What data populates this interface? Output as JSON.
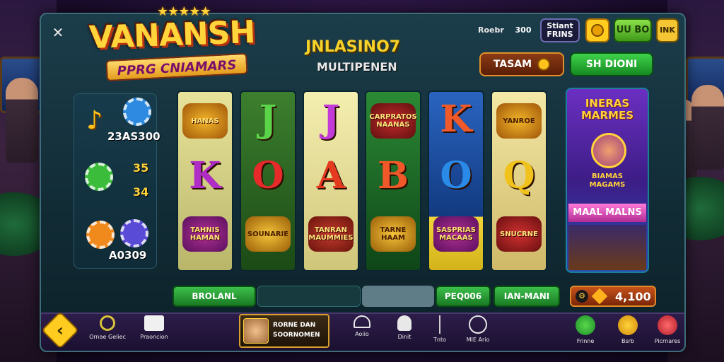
{
  "logo": {
    "stars": "★★★★★",
    "main": "VANANSH",
    "sub": "PPRG CNIAMARS"
  },
  "game": {
    "title": "JNLASINO7",
    "subtitle": "MULTIPENEN"
  },
  "header": {
    "close_label": "✕",
    "label_text": "Roebr",
    "value_box": "300",
    "smart_box": "Stiant FRINS",
    "coin_icon": "coin-icon",
    "green_box": "UU BO",
    "yellow_box": "INK"
  },
  "pills": {
    "bet_label": "TASAM",
    "win_label": "SH DIONI"
  },
  "stats": {
    "top_value": "23AS300",
    "mid_value_1": "35",
    "mid_value_2": "34",
    "bottom_value": "A0309"
  },
  "reels": [
    {
      "top": "HANAS",
      "mid": "K",
      "bottom": "TAHNIS HAMAN",
      "color": "#e8e39a"
    },
    {
      "top": "J",
      "mid": "O",
      "bottom": "SOUNARIE",
      "color": "#2e6b26"
    },
    {
      "top": "J",
      "mid": "A",
      "bottom": "TANRAN MAUMMIES",
      "color": "#f2eaa0"
    },
    {
      "top": "CARPRATOS NAANAS",
      "mid": "B",
      "bottom": "TARNE HAAM",
      "color": "#1f6b2a"
    },
    {
      "top": "K",
      "mid": "O",
      "bottom": "SASPRIAS MACAAS",
      "color": "#1f4f9b"
    },
    {
      "top": "YANROE",
      "mid": "Q",
      "bottom": "SNUCRNE",
      "color": "#f0e49b"
    }
  ],
  "promo": {
    "title": "INERAS MARMES",
    "mid": "BIAMAS MAGAMS",
    "banner": "MAAL MALNS"
  },
  "controls": {
    "left_label": "BROLANL",
    "mid_label": "PEQ006",
    "right_label": "IAN-MANI",
    "balance": "4,100"
  },
  "nav": [
    {
      "label": "",
      "icon": "back-arrow-icon"
    },
    {
      "label": "Ornae Geliec",
      "icon": "spiral-icon"
    },
    {
      "label": "Praoncion",
      "icon": "wallet-icon"
    },
    {
      "label": "",
      "icon": "profile-card-icon"
    },
    {
      "label": "Aoiio",
      "icon": "gauge-icon"
    },
    {
      "label": "Dinit",
      "icon": "mascot-icon"
    },
    {
      "label": "Tnto",
      "icon": "divider-icon"
    },
    {
      "label": "MIE Ario",
      "icon": "speedometer-icon"
    },
    {
      "label": "Frinne",
      "icon": "chat-icon"
    },
    {
      "label": "Bsrb",
      "icon": "smiley-icon"
    },
    {
      "label": "Picrnares",
      "icon": "gift-icon"
    }
  ],
  "profile_card": {
    "line1": "RORNE DAN",
    "line2": "SOORNOMEN"
  },
  "colors": {
    "gold": "#ffd53b",
    "green": "#2fae3a",
    "purple_bar": "#2d1d4a"
  }
}
